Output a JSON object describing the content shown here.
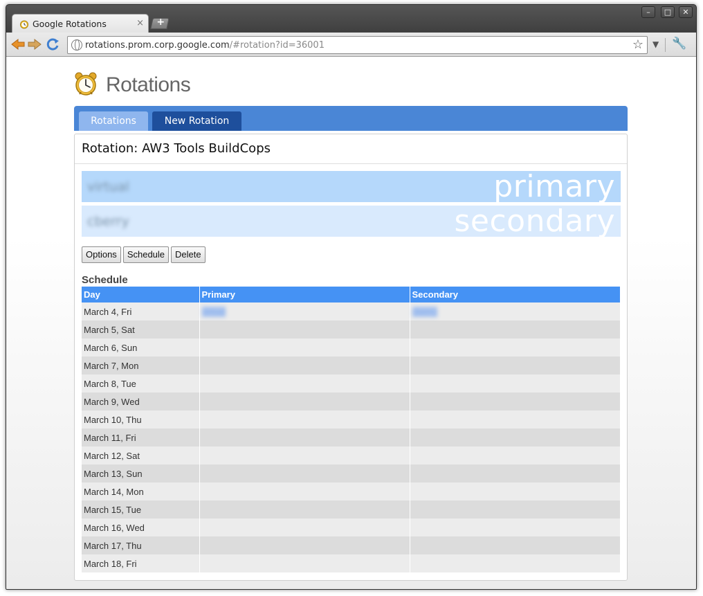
{
  "browser": {
    "tab_title": "Google Rotations",
    "tab_close": "×",
    "new_tab": "+",
    "address_host": "rotations.prom.corp.google.com",
    "address_path": "/#rotation?id=36001",
    "window_buttons": [
      "–",
      "□",
      "✕"
    ]
  },
  "app": {
    "logo_text": "Rotations"
  },
  "nav": {
    "tabs": [
      "Rotations",
      "New Rotation"
    ]
  },
  "rotation": {
    "title": "Rotation: AW3 Tools BuildCops",
    "primary_user": "virtual",
    "primary_label": "primary",
    "secondary_user": "cberry",
    "secondary_label": "secondary"
  },
  "actions": {
    "options": "Options",
    "schedule": "Schedule",
    "delete": "Delete"
  },
  "schedule": {
    "title": "Schedule",
    "columns": [
      "Day",
      "Primary",
      "Secondary"
    ],
    "rows": [
      {
        "day": "March 4, Fri",
        "primary": "virtual",
        "secondary": "cberry"
      },
      {
        "day": "March 5, Sat",
        "primary": "",
        "secondary": ""
      },
      {
        "day": "March 6, Sun",
        "primary": "",
        "secondary": ""
      },
      {
        "day": "March 7, Mon",
        "primary": "",
        "secondary": ""
      },
      {
        "day": "March 8, Tue",
        "primary": "",
        "secondary": ""
      },
      {
        "day": "March 9, Wed",
        "primary": "",
        "secondary": ""
      },
      {
        "day": "March 10, Thu",
        "primary": "",
        "secondary": ""
      },
      {
        "day": "March 11, Fri",
        "primary": "",
        "secondary": ""
      },
      {
        "day": "March 12, Sat",
        "primary": "",
        "secondary": ""
      },
      {
        "day": "March 13, Sun",
        "primary": "",
        "secondary": ""
      },
      {
        "day": "March 14, Mon",
        "primary": "",
        "secondary": ""
      },
      {
        "day": "March 15, Tue",
        "primary": "",
        "secondary": ""
      },
      {
        "day": "March 16, Wed",
        "primary": "",
        "secondary": ""
      },
      {
        "day": "March 17, Thu",
        "primary": "",
        "secondary": ""
      },
      {
        "day": "March 18, Fri",
        "primary": "",
        "secondary": ""
      }
    ]
  },
  "colors": {
    "nav_bar": "#4a86d6",
    "table_header": "#4592f4",
    "primary_band": "#b5d8fb",
    "secondary_band": "#d9eafd"
  }
}
